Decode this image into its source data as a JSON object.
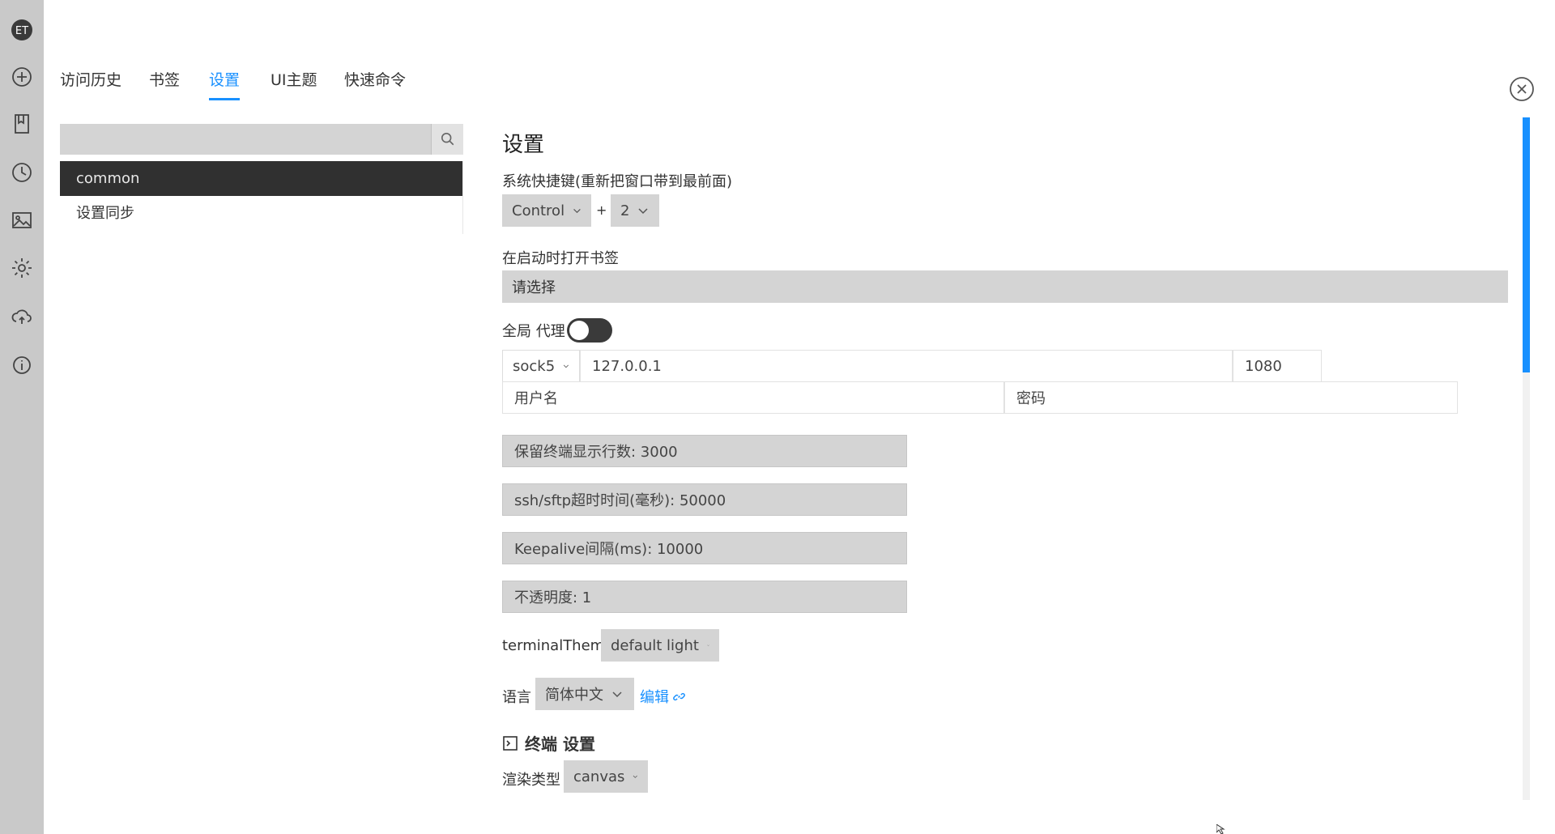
{
  "rail": {
    "logo_text": "ET",
    "icons": [
      "logo-icon",
      "add-icon",
      "bookmark-icon",
      "history-icon",
      "image-icon",
      "settings-icon",
      "cloud-sync-icon",
      "info-icon"
    ]
  },
  "tabs": [
    {
      "label": "访问历史",
      "active": false
    },
    {
      "label": "书签",
      "active": false
    },
    {
      "label": "设置",
      "active": true
    },
    {
      "label": "UI主题",
      "active": false
    },
    {
      "label": "快速命令",
      "active": false
    }
  ],
  "search": {
    "value": "",
    "placeholder": ""
  },
  "list": [
    {
      "label": "common",
      "active": true
    },
    {
      "label": "设置同步",
      "active": false
    }
  ],
  "settings": {
    "title": "设置",
    "hotkey_label": "系统快捷键(重新把窗口带到最前面)",
    "hotkey_modifier": "Control",
    "hotkey_plus": "+",
    "hotkey_key": "2",
    "open_bookmark_label": "在启动时打开书签",
    "open_bookmark_placeholder": "请选择",
    "proxy_label": "全局 代理",
    "proxy_enabled": false,
    "proxy_type": "sock5",
    "proxy_host": "127.0.0.1",
    "proxy_port": "1080",
    "proxy_username_placeholder": "用户名",
    "proxy_password_placeholder": "密码",
    "scrollback": "保留终端显示行数: 3000",
    "ssh_timeout": "ssh/sftp超时时间(毫秒): 50000",
    "keepalive": "Keepalive间隔(ms): 10000",
    "opacity": "不透明度: 1",
    "terminal_theme_label": "terminalTheme",
    "terminal_theme_value": "default light",
    "language_label": "语言",
    "language_value": "简体中文",
    "language_edit_link": "编辑",
    "terminal_section_title": "终端 设置",
    "renderer_label": "渲染类型",
    "renderer_value": "canvas"
  },
  "colors": {
    "accent": "#1890ff",
    "rail_bg": "#c9c9c9",
    "active_item_bg": "#303030",
    "field_bg": "#d4d4d4"
  }
}
